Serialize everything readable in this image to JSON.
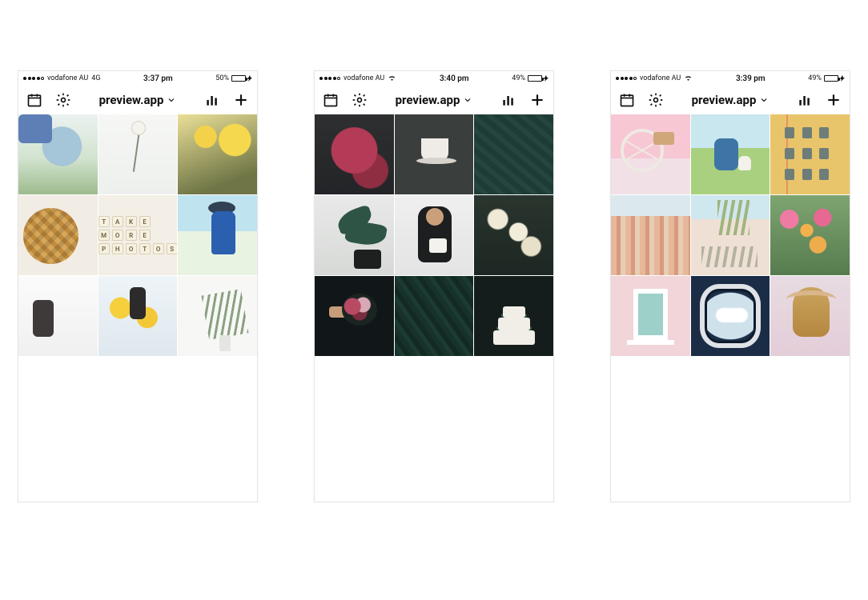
{
  "phones": [
    {
      "status": {
        "carrier": "vodafone AU",
        "network": "4G",
        "time": "3:37 pm",
        "battery_pct": "50%",
        "battery_fill": 50,
        "signal_filled": 4
      },
      "nav": {
        "title": "preview.app"
      },
      "scrabble": [
        "T",
        "A",
        "K",
        "E",
        "",
        "",
        "M",
        "O",
        "R",
        "E",
        "",
        "",
        "P",
        "H",
        "O",
        "T",
        "O",
        "S"
      ]
    },
    {
      "status": {
        "carrier": "vodafone AU",
        "network": "wifi",
        "time": "3:40 pm",
        "battery_pct": "49%",
        "battery_fill": 49,
        "signal_filled": 4
      },
      "nav": {
        "title": "preview.app"
      }
    },
    {
      "status": {
        "carrier": "vodafone AU",
        "network": "wifi",
        "time": "3:39 pm",
        "battery_pct": "49%",
        "battery_fill": 49,
        "signal_filled": 4
      },
      "nav": {
        "title": "preview.app"
      }
    }
  ]
}
